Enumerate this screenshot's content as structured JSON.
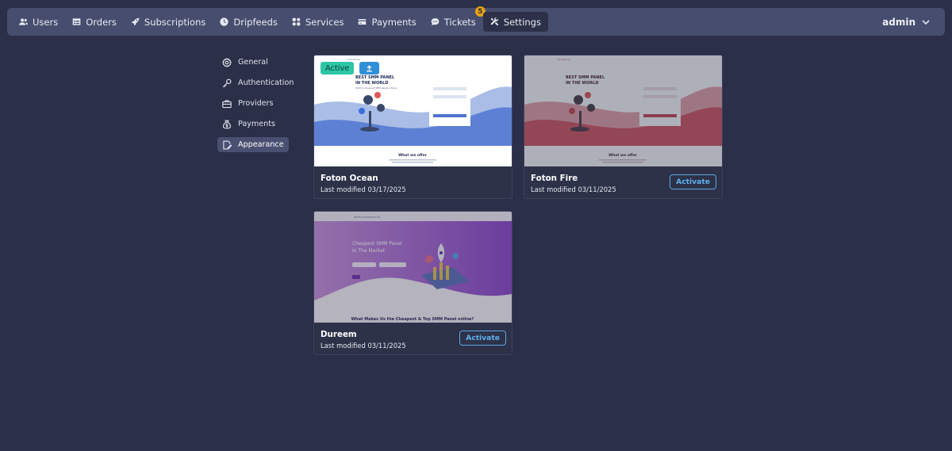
{
  "nav": {
    "items": [
      {
        "label": "Users",
        "icon": "users-icon"
      },
      {
        "label": "Orders",
        "icon": "table-icon"
      },
      {
        "label": "Subscriptions",
        "icon": "rocket-icon"
      },
      {
        "label": "Dripfeeds",
        "icon": "clock-icon"
      },
      {
        "label": "Services",
        "icon": "grid-icon"
      },
      {
        "label": "Payments",
        "icon": "wallet-icon"
      },
      {
        "label": "Tickets",
        "icon": "chat-icon",
        "badge": "5"
      },
      {
        "label": "Settings",
        "icon": "tools-icon",
        "active": true
      }
    ],
    "user": "admin"
  },
  "side": {
    "items": [
      {
        "label": "General"
      },
      {
        "label": "Authentication"
      },
      {
        "label": "Providers"
      },
      {
        "label": "Payments"
      },
      {
        "label": "Appearance",
        "active": true
      }
    ]
  },
  "themes": [
    {
      "name": "Foton Ocean",
      "modified": "Last modified 03/17/2025",
      "status": "Active",
      "preview": {
        "brand": "SmartPanel",
        "headline1": "BEST SMM PANEL",
        "headline2": "IN THE WORLD",
        "tagline": "World's Cheapest SMM Reseller Panel",
        "section": "What we offer"
      }
    },
    {
      "name": "Foton Fire",
      "modified": "Last modified 03/11/2025",
      "action": "Activate",
      "preview": {
        "brand": "SmartPanel",
        "headline1": "BEST SMM PANEL",
        "headline2": "IN THE WORLD",
        "section": "What we offer"
      }
    },
    {
      "name": "Dureem",
      "modified": "Last modified 03/11/2025",
      "action": "Activate",
      "preview": {
        "brand": "demo.propanel.io",
        "headline1": "Cheapest SMM Panel",
        "headline2": "In The Market",
        "section": "What Makes Us the Cheapest & Top SMM Panel online?"
      }
    }
  ],
  "colors": {
    "background": "#2b2f47",
    "nav": "#474d6e",
    "accent": "#5fb0ee",
    "active_pill": "#2cc6a7",
    "badge": "#e7a410"
  }
}
